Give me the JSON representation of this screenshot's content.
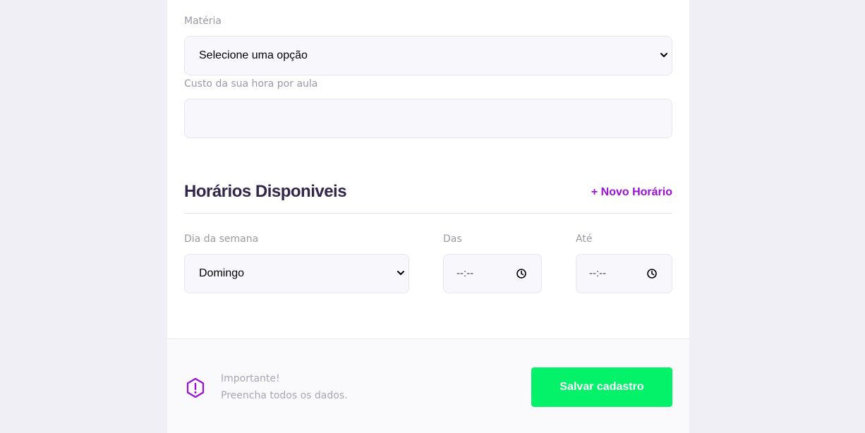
{
  "form": {
    "subject": {
      "label": "Matéria",
      "value": "Selecione uma opção"
    },
    "cost": {
      "label": "Custo da sua hora por aula",
      "value": ""
    }
  },
  "schedule": {
    "title": "Horários Disponiveis",
    "add_label": "+ Novo Horário",
    "weekday": {
      "label": "Dia da semana",
      "value": "Domingo"
    },
    "from": {
      "label": "Das",
      "value": "--:--"
    },
    "to": {
      "label": "Até",
      "value": "--:--"
    }
  },
  "footer": {
    "note_title": "Importante!",
    "note_text": "Preencha todos os dados.",
    "save_label": "Salvar cadastro"
  },
  "colors": {
    "page_bg": "#f0eff5",
    "title": "#32264d",
    "accent": "#9a10d8",
    "save": "#04f26a"
  },
  "icons": [
    "chevron-down-icon",
    "clock-icon",
    "warning-icon"
  ]
}
